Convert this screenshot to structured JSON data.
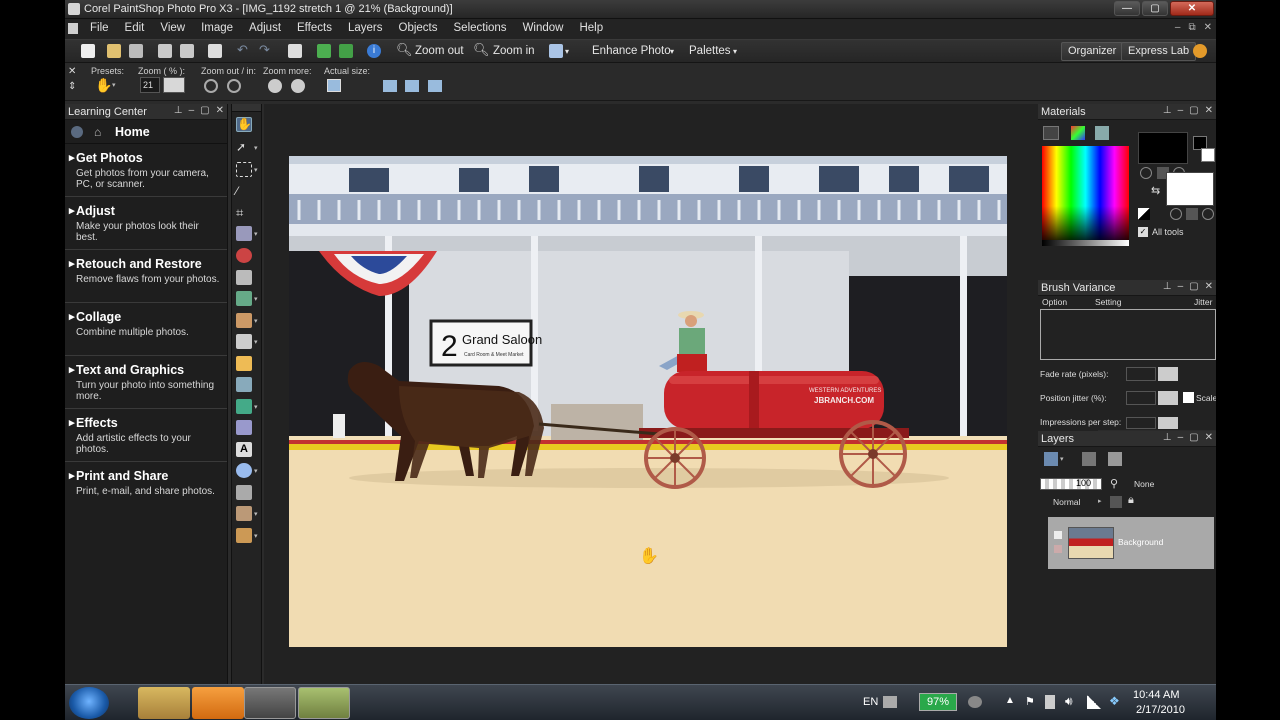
{
  "window": {
    "title": "Corel PaintShop Photo Pro X3 - [IMG_1192 stretch 1 @  21% (Background)]",
    "buttons": [
      "—",
      "▢",
      "✕"
    ]
  },
  "menu": {
    "items": [
      "File",
      "Edit",
      "View",
      "Image",
      "Adjust",
      "Effects",
      "Layers",
      "Objects",
      "Selections",
      "Window",
      "Help"
    ],
    "mdi_buttons": [
      "–",
      "⧉",
      "✕"
    ]
  },
  "toolbar": {
    "zoom_out": "Zoom out",
    "zoom_in": "Zoom in",
    "enhance_photo": "Enhance Photo",
    "palettes": "Palettes",
    "organizer": "Organizer",
    "express_lab": "Express Lab"
  },
  "options": {
    "presets_label": "Presets:",
    "zoom_label": "Zoom ( % ):",
    "zoom_value": "21",
    "zoom_out_in_label": "Zoom out / in:",
    "zoom_more_label": "Zoom more:",
    "actual_size_label": "Actual size:"
  },
  "learning_center": {
    "title": "Learning Center",
    "home": "Home",
    "items": [
      {
        "title": "Get Photos",
        "desc": "Get photos from your camera, PC, or scanner."
      },
      {
        "title": "Adjust",
        "desc": "Make your photos look their best."
      },
      {
        "title": "Retouch and Restore",
        "desc": "Remove flaws from your photos."
      },
      {
        "title": "Collage",
        "desc": "Combine multiple photos."
      },
      {
        "title": "Text and Graphics",
        "desc": "Turn your photo into something more."
      },
      {
        "title": "Effects",
        "desc": "Add artistic effects to your photos."
      },
      {
        "title": "Print and Share",
        "desc": "Print, e-mail, and share photos."
      }
    ]
  },
  "photo": {
    "sign_number": "2",
    "sign_text": "Grand Saloon",
    "sign_sub": "Card Room & Meet Market",
    "tank_text_1": "WESTERN ADVENTURES",
    "tank_text_2": "JBRANCH.COM"
  },
  "materials": {
    "title": "Materials",
    "all_tools": "All tools"
  },
  "brush_variance": {
    "title": "Brush Variance",
    "col_option": "Option",
    "col_setting": "Setting",
    "col_jitter": "Jitter (",
    "fade_rate": "Fade rate (pixels):",
    "position_jitter": "Position jitter (%):",
    "scale": "Scale",
    "impressions": "Impressions per step:"
  },
  "layers": {
    "title": "Layers",
    "opacity": "100",
    "blend_mode": "Normal",
    "none_label": "None",
    "layer_name": "Background"
  },
  "taskbar": {
    "language": "EN",
    "battery": "97%",
    "time": "10:44 AM",
    "date": "2/17/2010"
  },
  "colors": {
    "accent": "#3a6ea5",
    "battery_green": "#2aa84a",
    "selected_layer": "#a9a9a9"
  }
}
